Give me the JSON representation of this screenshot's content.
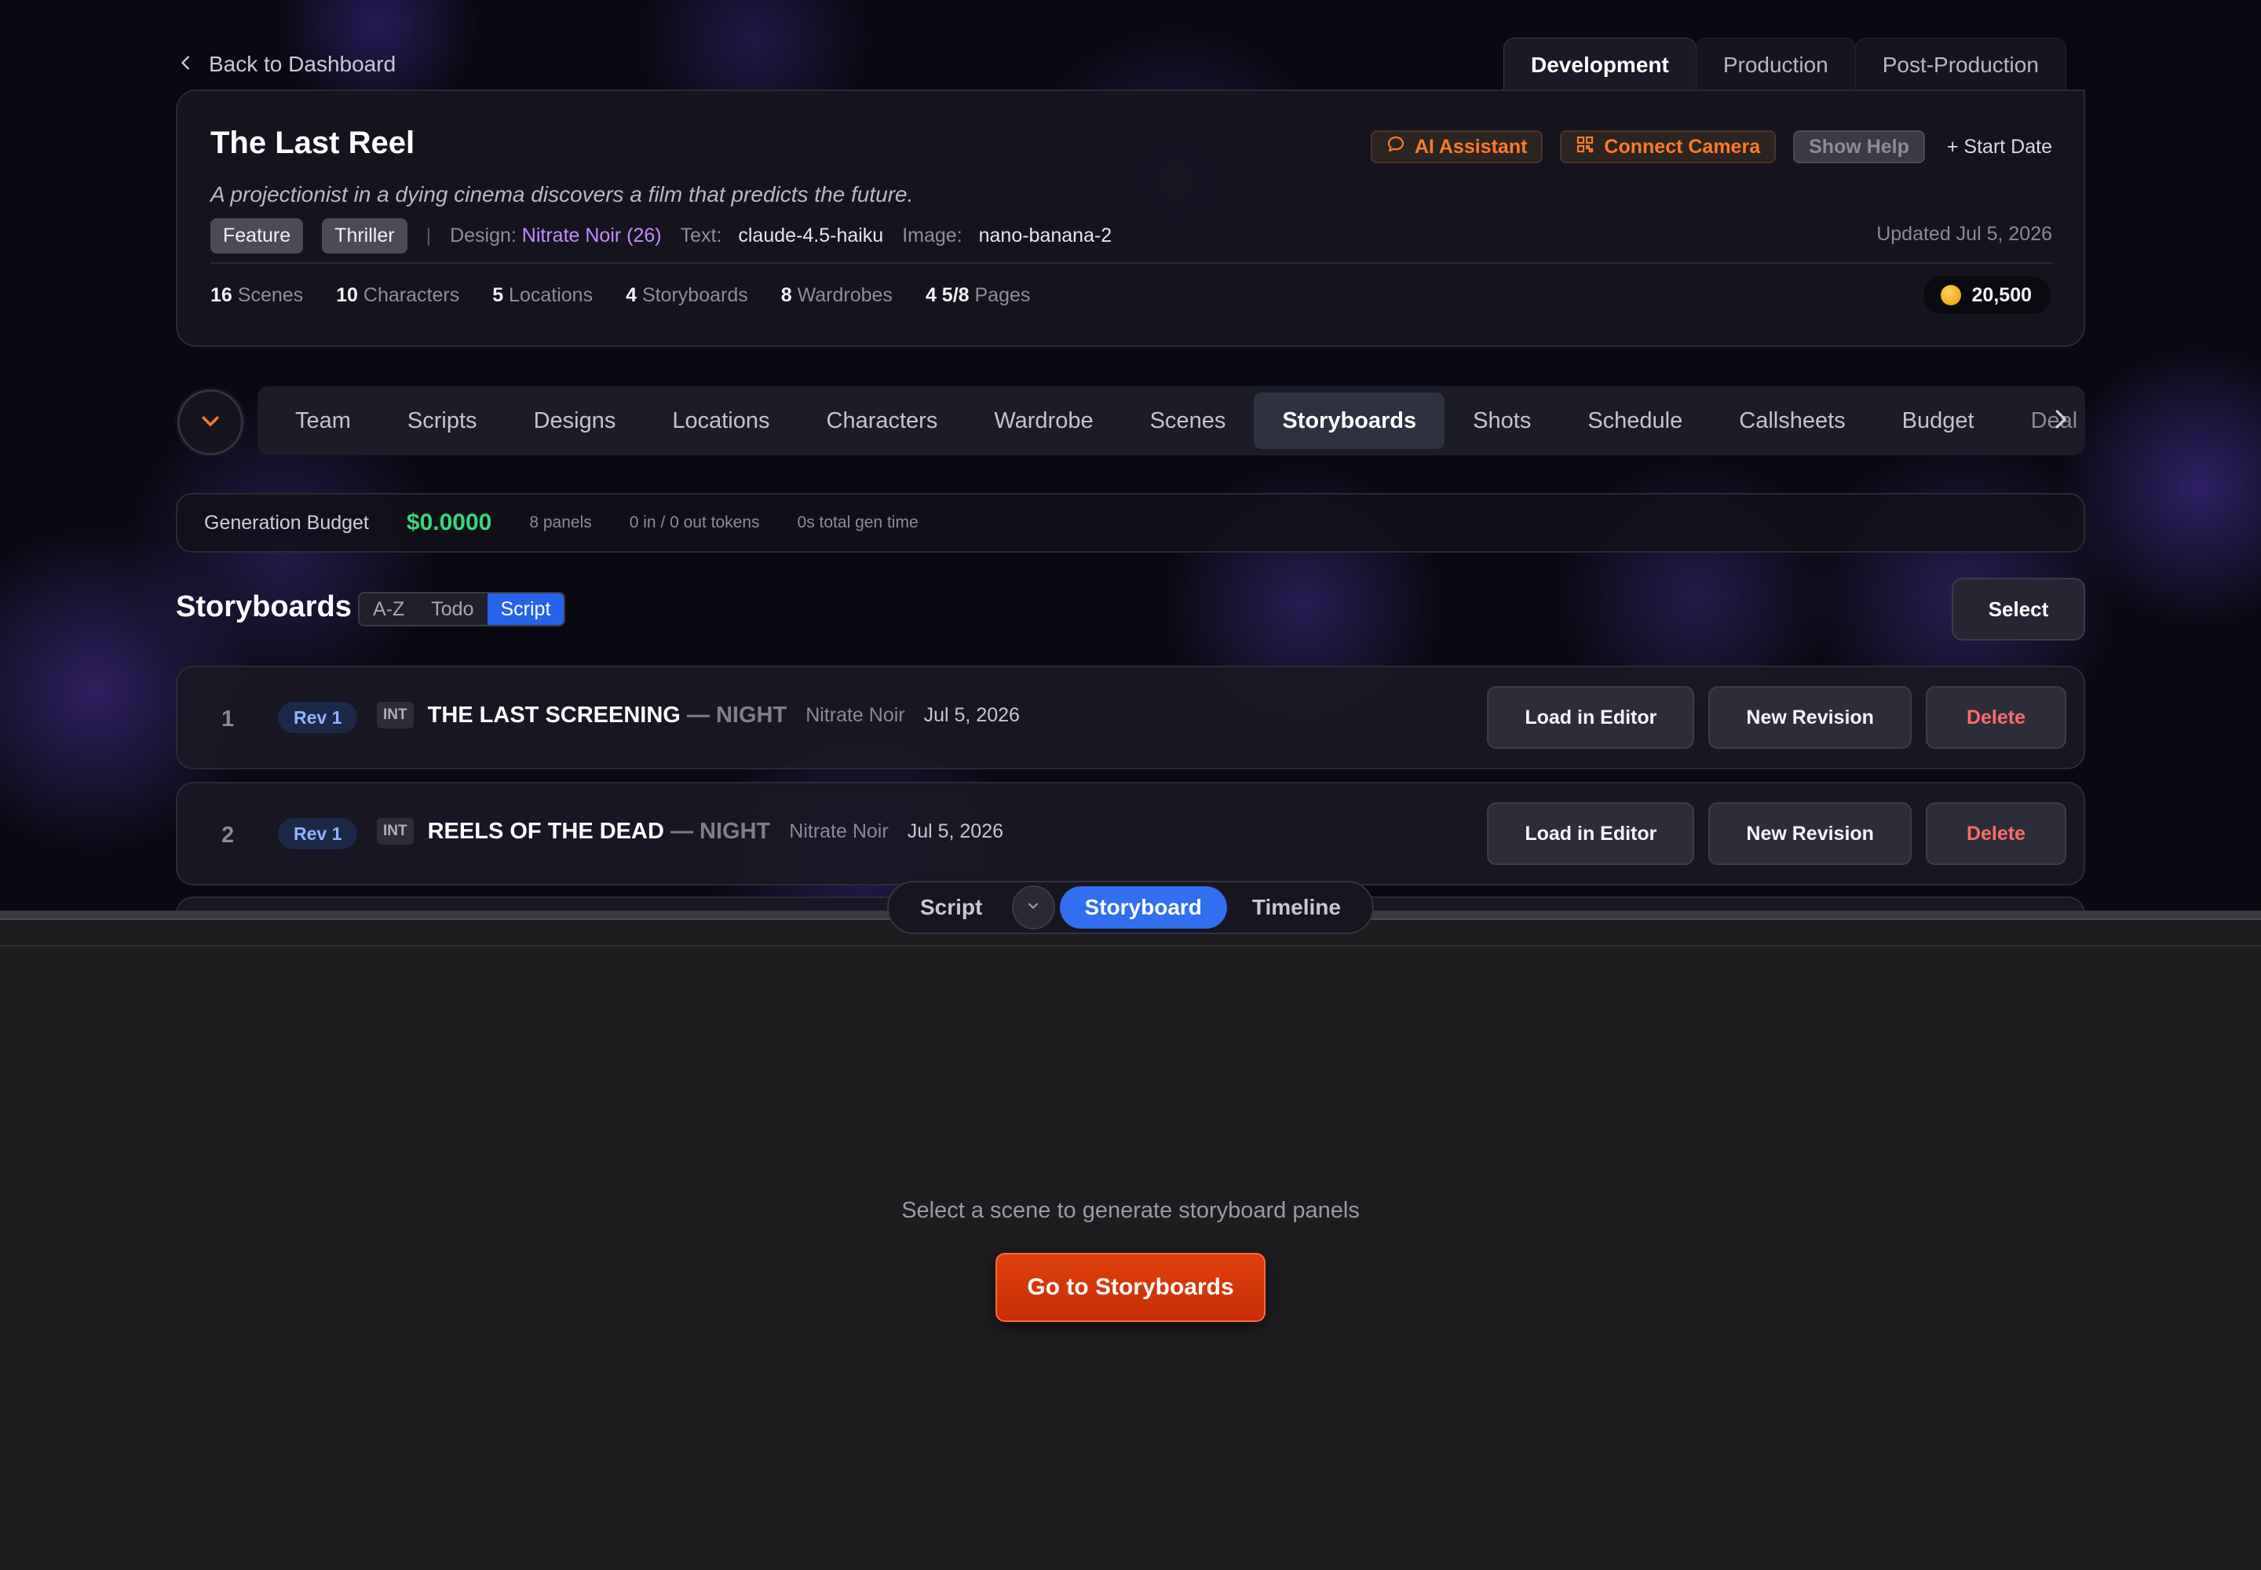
{
  "back_link": {
    "label": "Back to Dashboard"
  },
  "phase_tabs": [
    {
      "label": "Development",
      "active": true
    },
    {
      "label": "Production",
      "active": false
    },
    {
      "label": "Post-Production",
      "active": false
    }
  ],
  "project": {
    "title": "The Last Reel",
    "logline": "A projectionist in a dying cinema discovers a film that predicts the future.",
    "tags": [
      "Feature",
      "Thriller"
    ],
    "separator": "|",
    "design_label": "Design:",
    "design_value": "Nitrate Noir (26)",
    "text_label": "Text:",
    "text_value": "claude-4.5-haiku",
    "image_label": "Image:",
    "image_value": "nano-banana-2",
    "updated": "Updated Jul 5, 2026",
    "actions": {
      "ai_assistant": "AI Assistant",
      "connect_camera": "Connect Camera",
      "show_help": "Show Help",
      "start_date": "+ Start Date"
    },
    "stats": [
      {
        "value": "16",
        "label": "Scenes"
      },
      {
        "value": "10",
        "label": "Characters"
      },
      {
        "value": "5",
        "label": "Locations"
      },
      {
        "value": "4",
        "label": "Storyboards"
      },
      {
        "value": "8",
        "label": "Wardrobes"
      },
      {
        "value": "4 5/8",
        "label": "Pages"
      }
    ],
    "credits": "20,500"
  },
  "tool_nav": {
    "tabs": [
      "Team",
      "Scripts",
      "Designs",
      "Locations",
      "Characters",
      "Wardrobe",
      "Scenes",
      "Storyboards",
      "Shots",
      "Schedule",
      "Callsheets",
      "Budget",
      "Deal"
    ],
    "active": "Storyboards"
  },
  "budget_bar": {
    "label": "Generation Budget",
    "amount": "$0.0000",
    "panels": "8 panels",
    "tokens": "0 in / 0 out tokens",
    "gen_time": "0s total gen time"
  },
  "storyboards": {
    "title": "Storyboards",
    "sort_options": [
      {
        "label": "A-Z",
        "active": false
      },
      {
        "label": "Todo",
        "active": false
      },
      {
        "label": "Script",
        "active": true
      }
    ],
    "select_label": "Select",
    "rows": [
      {
        "num": "1",
        "rev": "Rev 1",
        "int": "INT",
        "slug": "THE LAST SCREENING",
        "tod": " — NIGHT",
        "style": "Nitrate Noir",
        "date": "Jul 5, 2026",
        "load": "Load in Editor",
        "revise": "New Revision",
        "delete": "Delete"
      },
      {
        "num": "2",
        "rev": "Rev 1",
        "int": "INT",
        "slug": "REELS OF THE DEAD",
        "tod": " — NIGHT",
        "style": "Nitrate Noir",
        "date": "Jul 5, 2026",
        "load": "Load in Editor",
        "revise": "New Revision",
        "delete": "Delete"
      }
    ]
  },
  "view_switch": {
    "script": "Script",
    "storyboard": "Storyboard",
    "timeline": "Timeline",
    "active": "Storyboard"
  },
  "empty_state": {
    "message": "Select a scene to generate storyboard panels",
    "button": "Go to Storyboards"
  },
  "colors": {
    "accent_blue": "#2563eb",
    "accent_orange": "#ff7a2a",
    "budget_green": "#39d67a",
    "danger": "#ff6b6b",
    "design_violet": "#c48cff"
  }
}
